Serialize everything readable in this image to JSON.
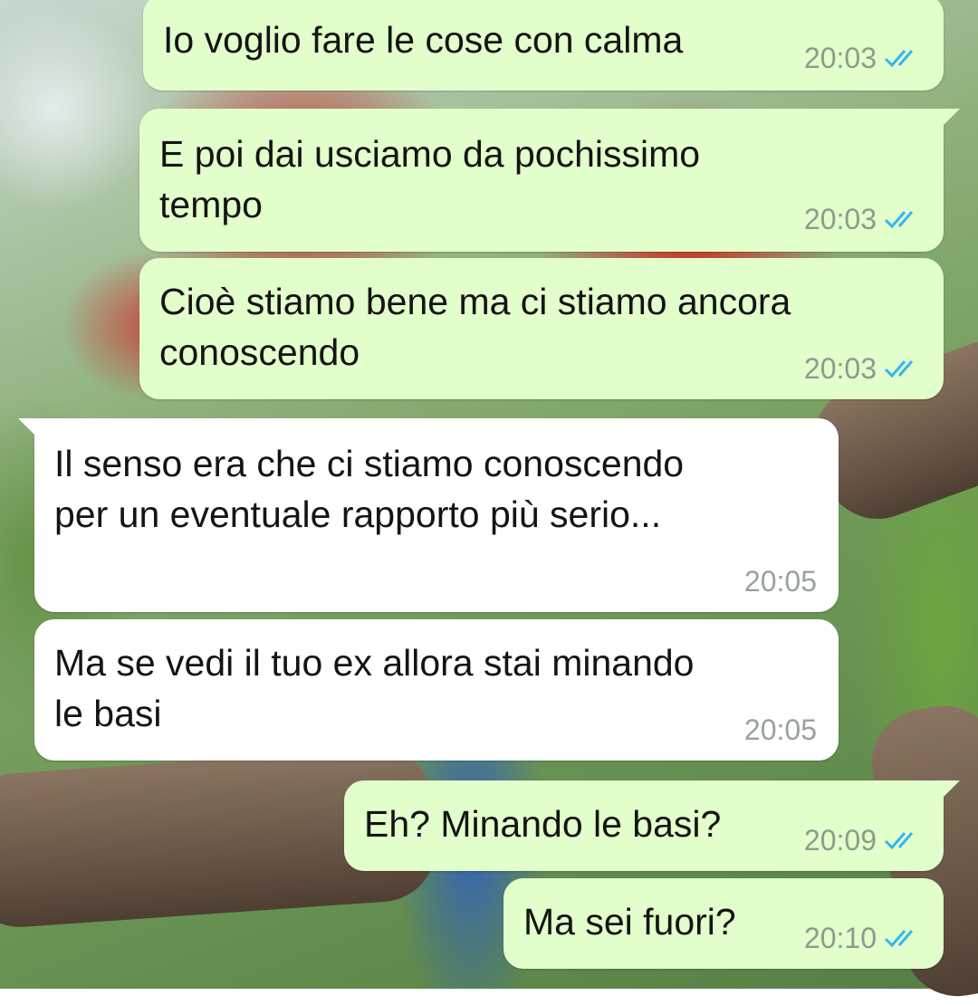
{
  "messages": [
    {
      "text_lines": [
        "Io voglio fare le cose con calma"
      ],
      "time": "20:03",
      "direction": "outgoing",
      "status": "read"
    },
    {
      "text_lines": [
        "E poi dai usciamo da pochissimo",
        "tempo"
      ],
      "time": "20:03",
      "direction": "outgoing",
      "status": "read"
    },
    {
      "text_lines": [
        "Cioè stiamo bene ma ci stiamo ancora",
        "conoscendo"
      ],
      "time": "20:03",
      "direction": "outgoing",
      "status": "read"
    },
    {
      "text_lines": [
        "Il senso era che ci stiamo conoscendo",
        "per un eventuale rapporto più serio..."
      ],
      "time": "20:05",
      "direction": "incoming"
    },
    {
      "text_lines": [
        "Ma se vedi il tuo ex allora stai minando",
        "le basi"
      ],
      "time": "20:05",
      "direction": "incoming"
    },
    {
      "text_lines": [
        "Eh? Minando le basi?"
      ],
      "time": "20:09",
      "direction": "outgoing",
      "status": "read"
    },
    {
      "text_lines": [
        "Ma sei fuori?"
      ],
      "time": "20:10",
      "direction": "outgoing",
      "status": "read"
    }
  ],
  "colors": {
    "outgoing_bubble": "#e2fecb",
    "incoming_bubble": "#ffffff",
    "read_ticks": "#34b7f1"
  },
  "icons": {
    "status_read": "double-check-icon"
  }
}
